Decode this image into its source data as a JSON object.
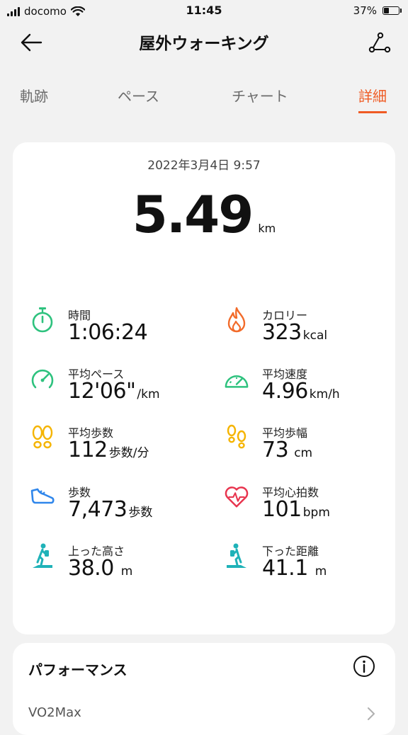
{
  "status_bar": {
    "carrier": "docomo",
    "time": "11:45",
    "battery_percent": "37%",
    "battery_level": 0.37
  },
  "header": {
    "title": "屋外ウォーキング",
    "back_icon": "arrow-left-icon",
    "route_icon": "route-icon"
  },
  "tabs": [
    {
      "label": "軌跡",
      "active": false
    },
    {
      "label": "ペース",
      "active": false
    },
    {
      "label": "チャート",
      "active": false
    },
    {
      "label": "詳細",
      "active": true
    }
  ],
  "summary": {
    "datetime": "2022年3月4日 9:57",
    "distance": "5.49",
    "distance_unit": "km"
  },
  "stats": {
    "time": {
      "label": "時間",
      "value": "1:06:24",
      "unit": "",
      "icon": "stopwatch-icon"
    },
    "calories": {
      "label": "カロリー",
      "value": "323",
      "unit": "kcal",
      "icon": "flame-icon"
    },
    "avg_pace": {
      "label": "平均ペース",
      "value": "12'06\"",
      "unit": "/km",
      "icon": "pace-gauge-icon"
    },
    "avg_speed": {
      "label": "平均速度",
      "value": "4.96",
      "unit": "km/h",
      "icon": "speedometer-icon"
    },
    "avg_cadence": {
      "label": "平均歩数",
      "value": "112",
      "unit": "歩数/分",
      "icon": "footprints-icon"
    },
    "avg_stride": {
      "label": "平均歩幅",
      "value": "73",
      "unit": "cm",
      "icon": "footprints-icon"
    },
    "steps": {
      "label": "歩数",
      "value": "7,473",
      "unit": "歩数",
      "icon": "shoe-icon"
    },
    "avg_heart_rate": {
      "label": "平均心拍数",
      "value": "101",
      "unit": "bpm",
      "icon": "heart-rate-icon"
    },
    "ascent": {
      "label": "上った高さ",
      "value": "38.0",
      "unit": "m",
      "icon": "hiker-icon"
    },
    "descent": {
      "label": "下った距離",
      "value": "41.1",
      "unit": "m",
      "icon": "hiker-icon"
    }
  },
  "performance": {
    "title": "パフォーマンス",
    "vo2_label": "VO2Max"
  },
  "colors": {
    "accent": "#ef5b24",
    "green": "#2ec27e",
    "orange": "#f26b2a",
    "yellow": "#f5b400",
    "blue": "#2f86eb",
    "red": "#e8344e",
    "teal": "#1fb2b8"
  }
}
